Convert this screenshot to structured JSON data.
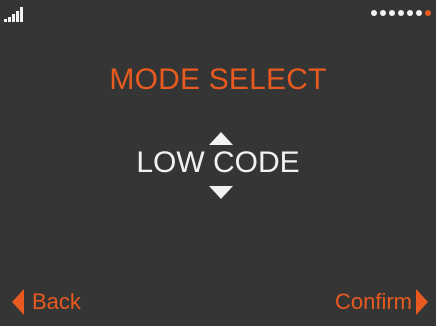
{
  "status": {
    "signal_bars": 5,
    "page_indicator": {
      "total": 7,
      "active_index": 6
    }
  },
  "screen": {
    "title": "MODE SELECT",
    "value": "LOW CODE"
  },
  "footer": {
    "back_label": "Back",
    "confirm_label": "Confirm"
  },
  "colors": {
    "background": "#353535",
    "accent": "#e85a1f",
    "foreground": "#f2f2f2"
  },
  "icons": {
    "signal": "signal-strength-icon",
    "up": "triangle-up-icon",
    "down": "triangle-down-icon",
    "back": "triangle-left-icon",
    "confirm": "triangle-right-icon"
  }
}
